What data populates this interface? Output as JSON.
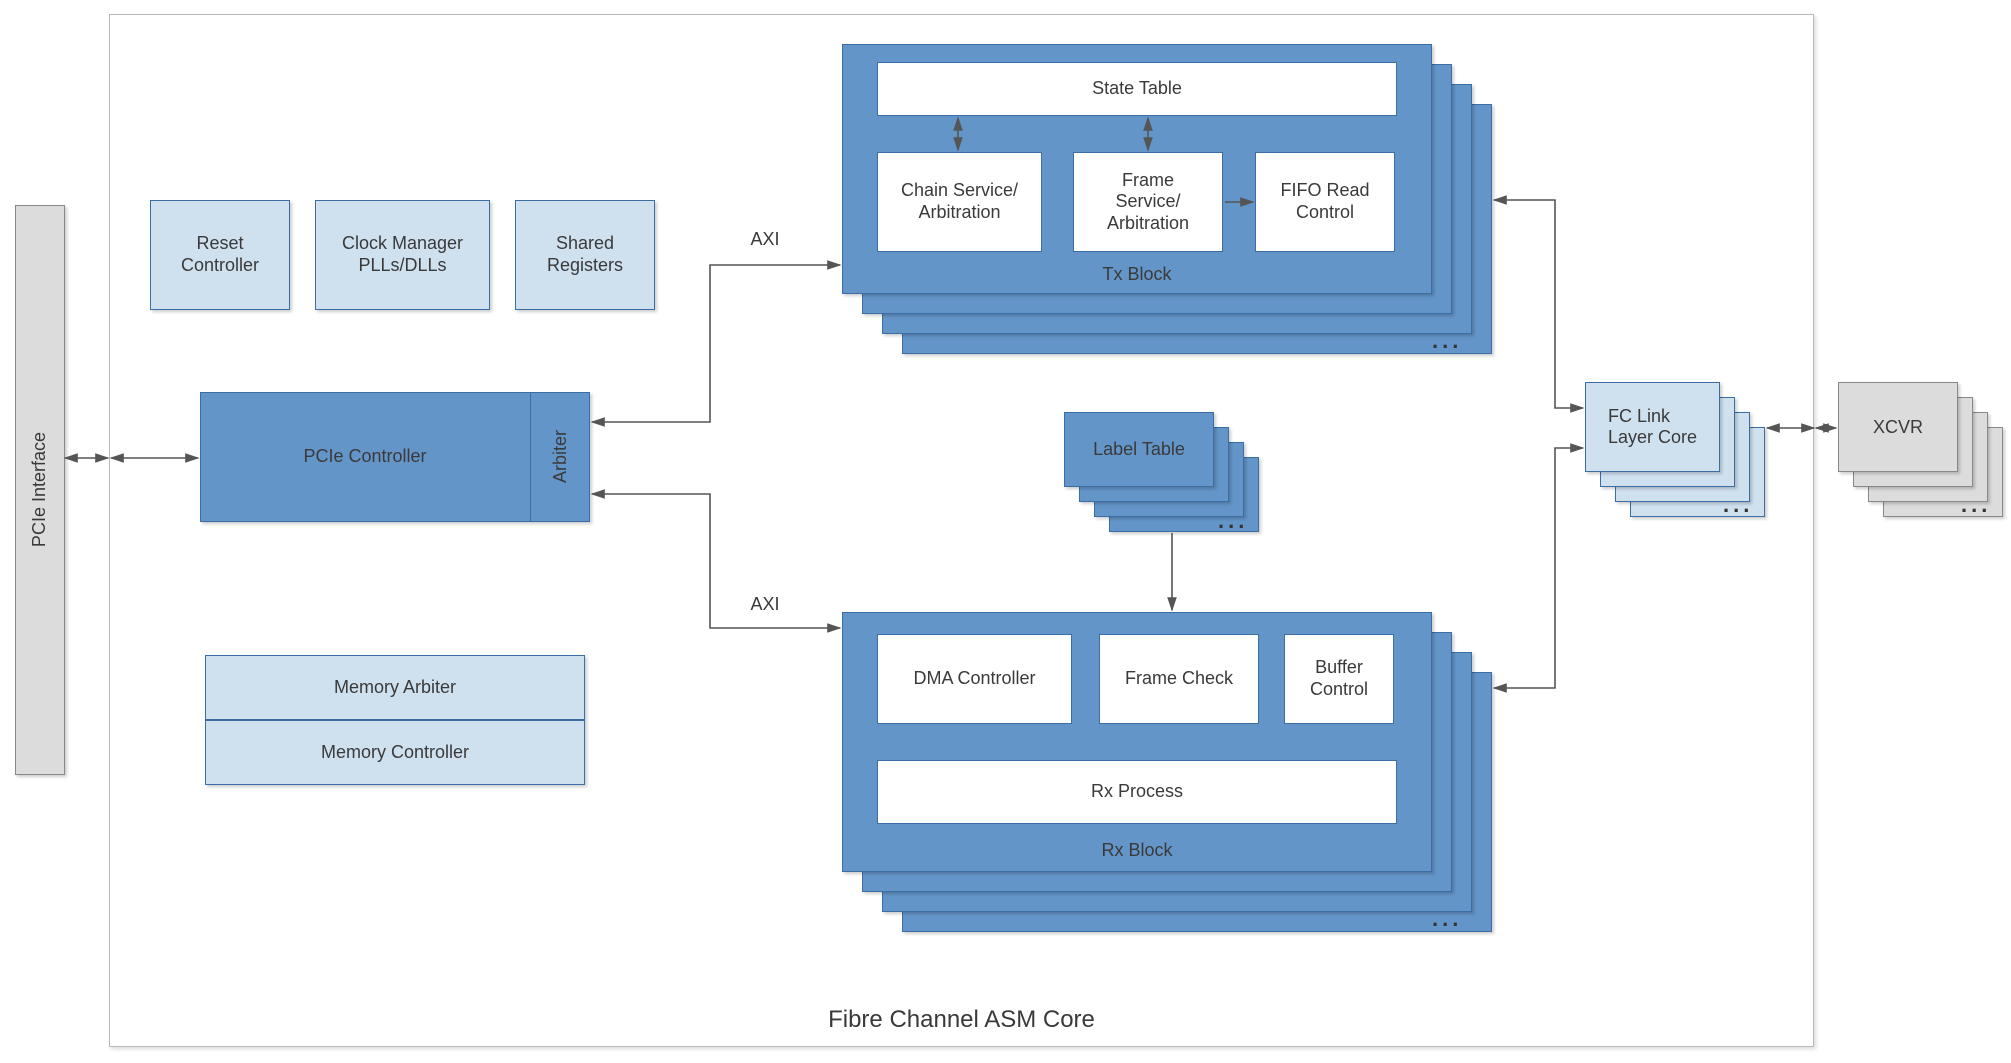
{
  "diagram": {
    "title": "Fibre Channel ASM Core",
    "pcie_interface": "PCIe Interface",
    "reset_controller": "Reset\nController",
    "clock_manager": "Clock Manager\nPLLs/DLLs",
    "shared_registers": "Shared\nRegisters",
    "pcie_controller": "PCIe Controller",
    "arbiter": "Arbiter",
    "memory_arbiter": "Memory Arbiter",
    "memory_controller": "Memory Controller",
    "axi_label": "AXI",
    "tx_block": {
      "label": "Tx Block",
      "state_table": "State Table",
      "chain_service": "Chain Service/\nArbitration",
      "frame_service": "Frame\nService/\nArbitration",
      "fifo_read": "FIFO Read\nControl"
    },
    "rx_block": {
      "label": "Rx Block",
      "dma_controller": "DMA Controller",
      "frame_check": "Frame Check",
      "buffer_control": "Buffer\nControl",
      "rx_process": "Rx Process"
    },
    "label_table": "Label Table",
    "fc_link": "FC Link\nLayer Core",
    "xcvr": "XCVR"
  }
}
